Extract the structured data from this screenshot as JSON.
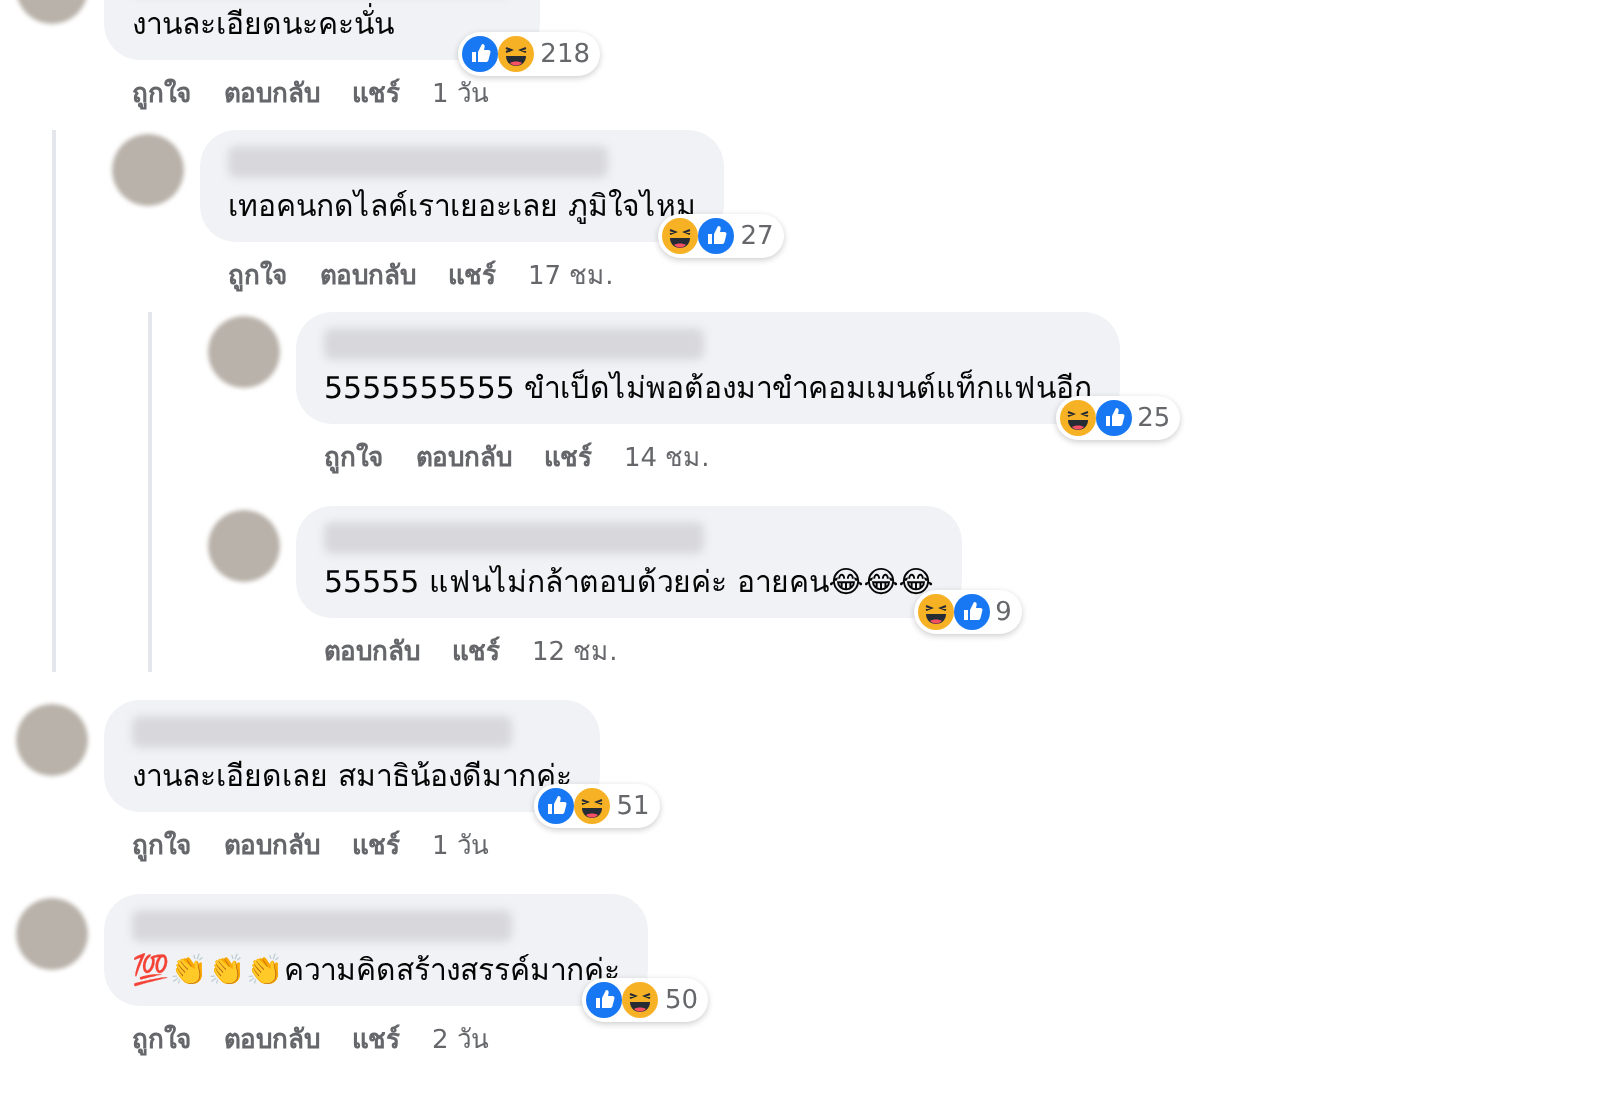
{
  "comments": [
    {
      "text": "งานละเอียดนะคะนั่น",
      "reactions": [
        {
          "kind": "like"
        },
        {
          "kind": "haha"
        }
      ],
      "count": "218",
      "actions": [
        "ถูกใจ",
        "ตอบกลับ",
        "แชร์"
      ],
      "time": "1 วัน",
      "children": [
        {
          "text": "เทอคนกดไลค์เราเยอะเลย ภูมิใจไหม",
          "reactions": [
            {
              "kind": "haha"
            },
            {
              "kind": "like"
            }
          ],
          "count": "27",
          "actions": [
            "ถูกใจ",
            "ตอบกลับ",
            "แชร์"
          ],
          "time": "17 ชม.",
          "children": [
            {
              "text": "5555555555 ขำเป็ดไม่พอต้องมาขำคอมเมนต์แท็กแฟนอีก",
              "reactions": [
                {
                  "kind": "haha"
                },
                {
                  "kind": "like"
                }
              ],
              "count": "25",
              "actions": [
                "ถูกใจ",
                "ตอบกลับ",
                "แชร์"
              ],
              "time": "14 ชม."
            },
            {
              "text": "55555 แฟนไม่กล้าตอบด้วยค่ะ อายคน😂😂😂",
              "reactions": [
                {
                  "kind": "haha"
                },
                {
                  "kind": "like"
                }
              ],
              "count": "9",
              "actions": [
                "ตอบกลับ",
                "แชร์"
              ],
              "time": "12 ชม."
            }
          ]
        }
      ]
    },
    {
      "text": "งานละเอียดเลย สมาธิน้องดีมากค่ะ",
      "reactions": [
        {
          "kind": "like"
        },
        {
          "kind": "haha"
        }
      ],
      "count": "51",
      "actions": [
        "ถูกใจ",
        "ตอบกลับ",
        "แชร์"
      ],
      "time": "1 วัน"
    },
    {
      "text": "💯👏👏👏ความคิดสร้างสรรค์มากค่ะ",
      "reactions": [
        {
          "kind": "like"
        },
        {
          "kind": "haha"
        }
      ],
      "count": "50",
      "actions": [
        "ถูกใจ",
        "ตอบกลับ",
        "แชร์"
      ],
      "time": "2 วัน"
    }
  ]
}
